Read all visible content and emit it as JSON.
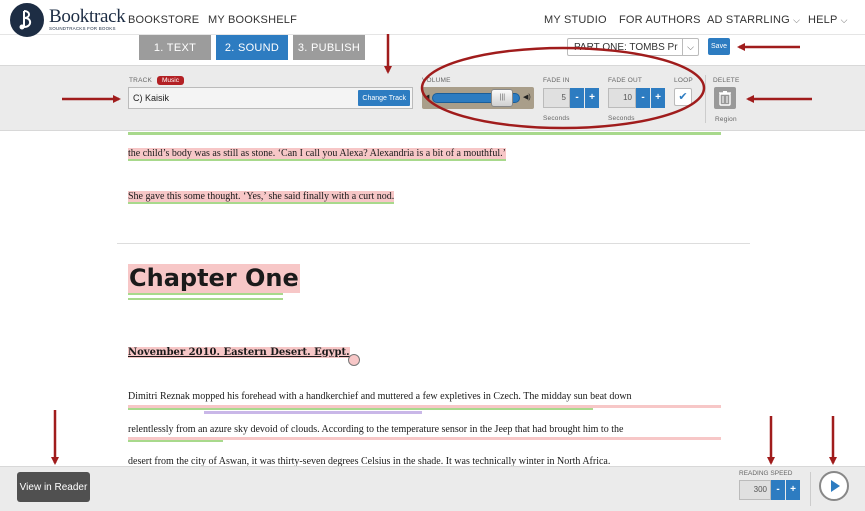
{
  "brand": {
    "name": "Booktrack",
    "tagline": "SOUNDTRACKS FOR BOOKS"
  },
  "nav": {
    "left": [
      "BOOKSTORE",
      "MY BOOKSHELF"
    ],
    "right": [
      "MY STUDIO",
      "FOR AUTHORS",
      "AD STARRLING",
      "HELP"
    ]
  },
  "tabs": [
    "1. TEXT",
    "2. SOUND",
    "3. PUBLISH"
  ],
  "active_tab": "2. SOUND",
  "part_select": {
    "value": "PART ONE: TOMBS Prolo"
  },
  "save_label": "Save",
  "toolbar": {
    "track_label": "TRACK",
    "music_badge": "Music",
    "track_value": "C) Kaisik",
    "change_track": "Change Track",
    "volume_label": "VOLUME",
    "volume_level": 0.8,
    "fade_in_label": "FADE IN",
    "fade_in_value": "5",
    "fade_out_label": "FADE OUT",
    "fade_out_value": "10",
    "seconds_label": "Seconds",
    "loop_label": "LOOP",
    "loop_checked": true,
    "delete_label": "DELETE",
    "region_label": "Region",
    "minus": "-",
    "plus": "+"
  },
  "manuscript": {
    "line1": "the child’s body was as still as stone. ‘Can I call you Alexa? Alexandria is a bit of a mouthful.’",
    "line2": "She gave this some thought. ‘Yes,’ she said finally with a curt nod.",
    "chapter": "Chapter One",
    "heading": "November 2010. Eastern Desert. Egypt.",
    "para1": "Dimitri Reznak mopped his forehead with a handkerchief and muttered a few expletives in Czech. The midday sun beat down",
    "para2": "relentlessly from an azure sky devoid of clouds. According to the temperature sensor in the Jeep that had brought him to the",
    "para3": "desert from the city of Aswan, it was thirty-seven degrees Celsius in the shade. It was technically winter in North Africa."
  },
  "bottom": {
    "view_reader": "View in Reader",
    "reading_speed_label": "READING SPEED",
    "reading_speed_value": "300",
    "minus": "-",
    "plus": "+"
  },
  "colors": {
    "accent": "#2d7cc1",
    "annotation": "#a01c1c",
    "highlight": "#f7c7c7",
    "underline": "#a8d98c"
  }
}
